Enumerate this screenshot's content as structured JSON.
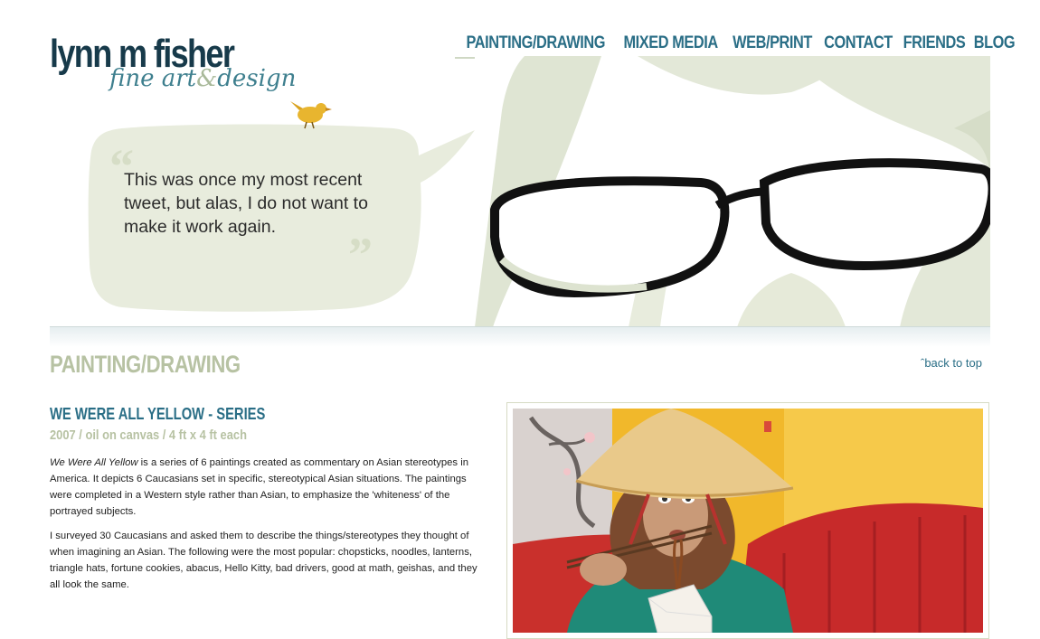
{
  "logo": {
    "main": "lynn m fisher",
    "sub_1": "fine art",
    "sub_amp": "&",
    "sub_2": "design"
  },
  "nav": [
    {
      "label": "PAINTING/DRAWING"
    },
    {
      "label": "MIXED MEDIA"
    },
    {
      "label": "WEB/PRINT"
    },
    {
      "label": "CONTACT"
    },
    {
      "label": "FRIENDS"
    },
    {
      "label": "BLOG"
    }
  ],
  "hero": {
    "tweet_text": "This was once my most recent tweet, but alas, I do not want to make it work again."
  },
  "section": {
    "title": "PAINTING/DRAWING",
    "back_to_top": "ˆback to top"
  },
  "work": {
    "title": "WE WERE ALL YELLOW - SERIES",
    "meta": "2007 / oil on canvas / 4 ft x 4 ft each",
    "p1_italic": "We Were All Yellow",
    "p1_rest": " is a series of 6 paintings created as commentary on Asian stereotypes in America. It depicts 6 Caucasians set in specific, stereotypical Asian situations. The paintings were completed in a Western style rather than Asian, to emphasize the 'whiteness' of the portrayed subjects.",
    "p2": "I surveyed 30 Caucasians and asked them to describe the things/stereotypes they thought of when imagining an Asian. The following were the most popular: chopsticks, noodles, lanterns, triangle hats, fortune cookies, abacus, Hello Kitty, bad drivers, good at math, geishas, and they all look the same."
  },
  "colors": {
    "accent": "#2a6e86",
    "logo_dark": "#173a4a",
    "sage": "#b7c2a3",
    "bubble": "#e8ecdd"
  }
}
